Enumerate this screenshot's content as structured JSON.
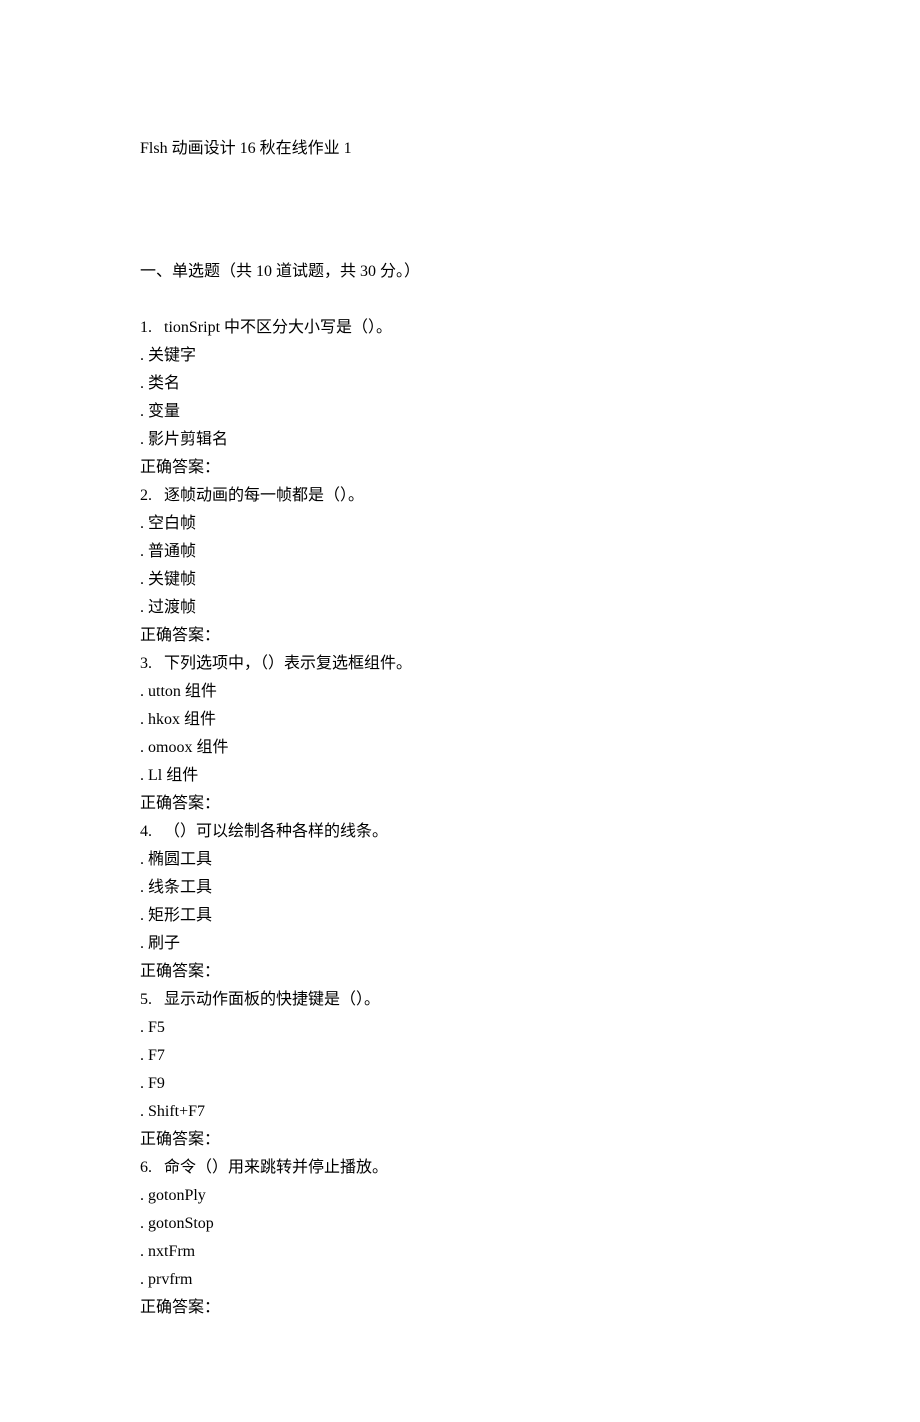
{
  "title": "Flsh 动画设计 16 秋在线作业 1",
  "section_header": "一、单选题（共 10 道试题，共 30 分。）",
  "questions": [
    {
      "num": "1.",
      "text": "  tionSript 中不区分大小写是（）。",
      "options": [
        ". 关键字",
        ". 类名",
        ". 变量",
        ". 影片剪辑名"
      ],
      "answer_label": "正确答案："
    },
    {
      "num": "2.",
      "text": "  逐帧动画的每一帧都是（）。",
      "options": [
        ". 空白帧",
        ". 普通帧",
        ". 关键帧",
        ". 过渡帧"
      ],
      "answer_label": "正确答案："
    },
    {
      "num": "3.",
      "text": "  下列选项中，（）表示复选框组件。",
      "options": [
        ". utton 组件",
        ". hkox 组件",
        ". omoox 组件",
        ". Ll 组件"
      ],
      "answer_label": "正确答案："
    },
    {
      "num": "4.",
      "text": "  （）可以绘制各种各样的线条。",
      "options": [
        ". 椭圆工具",
        ". 线条工具",
        ". 矩形工具",
        ". 刷子"
      ],
      "answer_label": "正确答案："
    },
    {
      "num": "5.",
      "text": "  显示动作面板的快捷键是（）。",
      "options": [
        ". F5",
        ". F7",
        ". F9",
        ". Shift+F7"
      ],
      "answer_label": "正确答案："
    },
    {
      "num": "6.",
      "text": "  命令（）用来跳转并停止播放。",
      "options": [
        ". gotonPly",
        ". gotonStop",
        ". nxtFrm",
        ". prvfrm"
      ],
      "answer_label": "正确答案："
    }
  ]
}
